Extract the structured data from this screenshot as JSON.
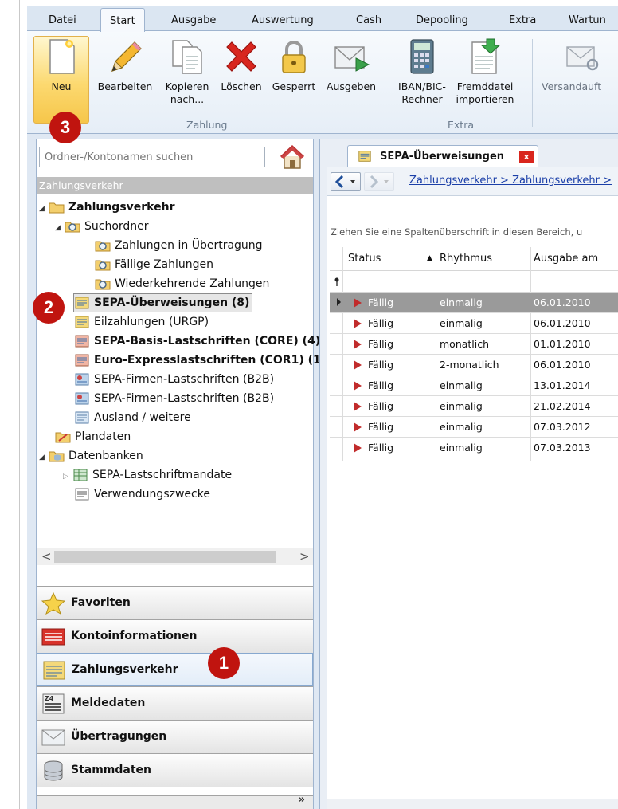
{
  "menu": {
    "tabs": [
      {
        "label": "Datei"
      },
      {
        "label": "Start"
      },
      {
        "label": "Ausgabe"
      },
      {
        "label": "Auswertung"
      },
      {
        "label": "Cash"
      },
      {
        "label": "Depooling"
      },
      {
        "label": "Extra"
      },
      {
        "label": "Wartun"
      }
    ],
    "active": "Start"
  },
  "ribbon": {
    "buttons": {
      "neu": {
        "label": "Neu",
        "icon": "new-document-icon"
      },
      "bearbeiten": {
        "label": "Bearbeiten",
        "icon": "pencil-icon"
      },
      "kopieren_1": "Kopieren",
      "kopieren_2": "nach...",
      "loeschen": {
        "label": "Löschen",
        "icon": "delete-x-icon"
      },
      "gesperrt": {
        "label": "Gesperrt",
        "icon": "padlock-icon"
      },
      "ausgeben": {
        "label": "Ausgeben",
        "icon": "send-envelope-icon"
      },
      "iban_1": "IBAN/BIC-",
      "iban_2": "Rechner",
      "fremd_1": "Fremddatei",
      "fremd_2": "importieren",
      "versand": {
        "label": "Versandauft",
        "icon": "envelope-search-icon"
      }
    },
    "groups": {
      "zahlung": "Zahlung",
      "extra": "Extra"
    }
  },
  "badges": {
    "one": "1",
    "two": "2",
    "three": "3"
  },
  "left": {
    "search_placeholder": "Ordner-/Kontonamen suchen",
    "pane_header": "Zahlungsverkehr",
    "tree": {
      "root": "Zahlungsverkehr",
      "suchordner": "Suchordner",
      "in_uebertragung": "Zahlungen in Übertragung",
      "faellig": "Fällige Zahlungen",
      "wiederkehrend": "Wiederkehrende Zahlungen",
      "sepa_ueberweisungen": "SEPA-Überweisungen (8)",
      "eilzahlungen": "Eilzahlungen (URGP)",
      "sepa_basis": "SEPA-Basis-Lastschriften (CORE) (4)",
      "euro_express": "Euro-Expresslastschriften (COR1) (1",
      "sepa_firmen_1": "SEPA-Firmen-Lastschriften (B2B)",
      "sepa_firmen_2": "SEPA-Firmen-Lastschriften (B2B)",
      "ausland": "Ausland / weitere",
      "plandaten": "Plandaten",
      "datenbanken": "Datenbanken",
      "mandate": "SEPA-Lastschriftmandate",
      "verwendung": "Verwendungszwecke"
    },
    "nav": {
      "favoriten": "Favoriten",
      "kontoinfo": "Kontoinformationen",
      "zahlungsverkehr": "Zahlungsverkehr",
      "meldedaten": "Meldedaten",
      "uebertragungen": "Übertragungen",
      "stammdaten": "Stammdaten"
    },
    "nav_active": "zahlungsverkehr"
  },
  "right": {
    "tab_title": "SEPA-Überweisungen",
    "tab_close": "x",
    "breadcrumb": "Zahlungsverkehr > Zahlungsverkehr >",
    "group_hint": "Ziehen Sie eine Spaltenüberschrift in diesen Bereich, u",
    "columns": {
      "status": "Status",
      "rhythmus": "Rhythmus",
      "ausgabe": "Ausgabe am"
    },
    "rows": [
      {
        "status": "Fällig",
        "rhythmus": "einmalig",
        "ausgabe": "06.01.2010"
      },
      {
        "status": "Fällig",
        "rhythmus": "einmalig",
        "ausgabe": "06.01.2010"
      },
      {
        "status": "Fällig",
        "rhythmus": "monatlich",
        "ausgabe": "01.01.2010"
      },
      {
        "status": "Fällig",
        "rhythmus": "2-monatlich",
        "ausgabe": "06.01.2010"
      },
      {
        "status": "Fällig",
        "rhythmus": "einmalig",
        "ausgabe": "13.01.2014"
      },
      {
        "status": "Fällig",
        "rhythmus": "einmalig",
        "ausgabe": "21.02.2014"
      },
      {
        "status": "Fällig",
        "rhythmus": "einmalig",
        "ausgabe": "07.03.2012"
      },
      {
        "status": "Fällig",
        "rhythmus": "einmalig",
        "ausgabe": "07.03.2013"
      }
    ],
    "selected_row": 0
  },
  "colors": {
    "accent": "#c0140f",
    "status_due": "#c12b2b",
    "link": "#1b3fa8"
  }
}
